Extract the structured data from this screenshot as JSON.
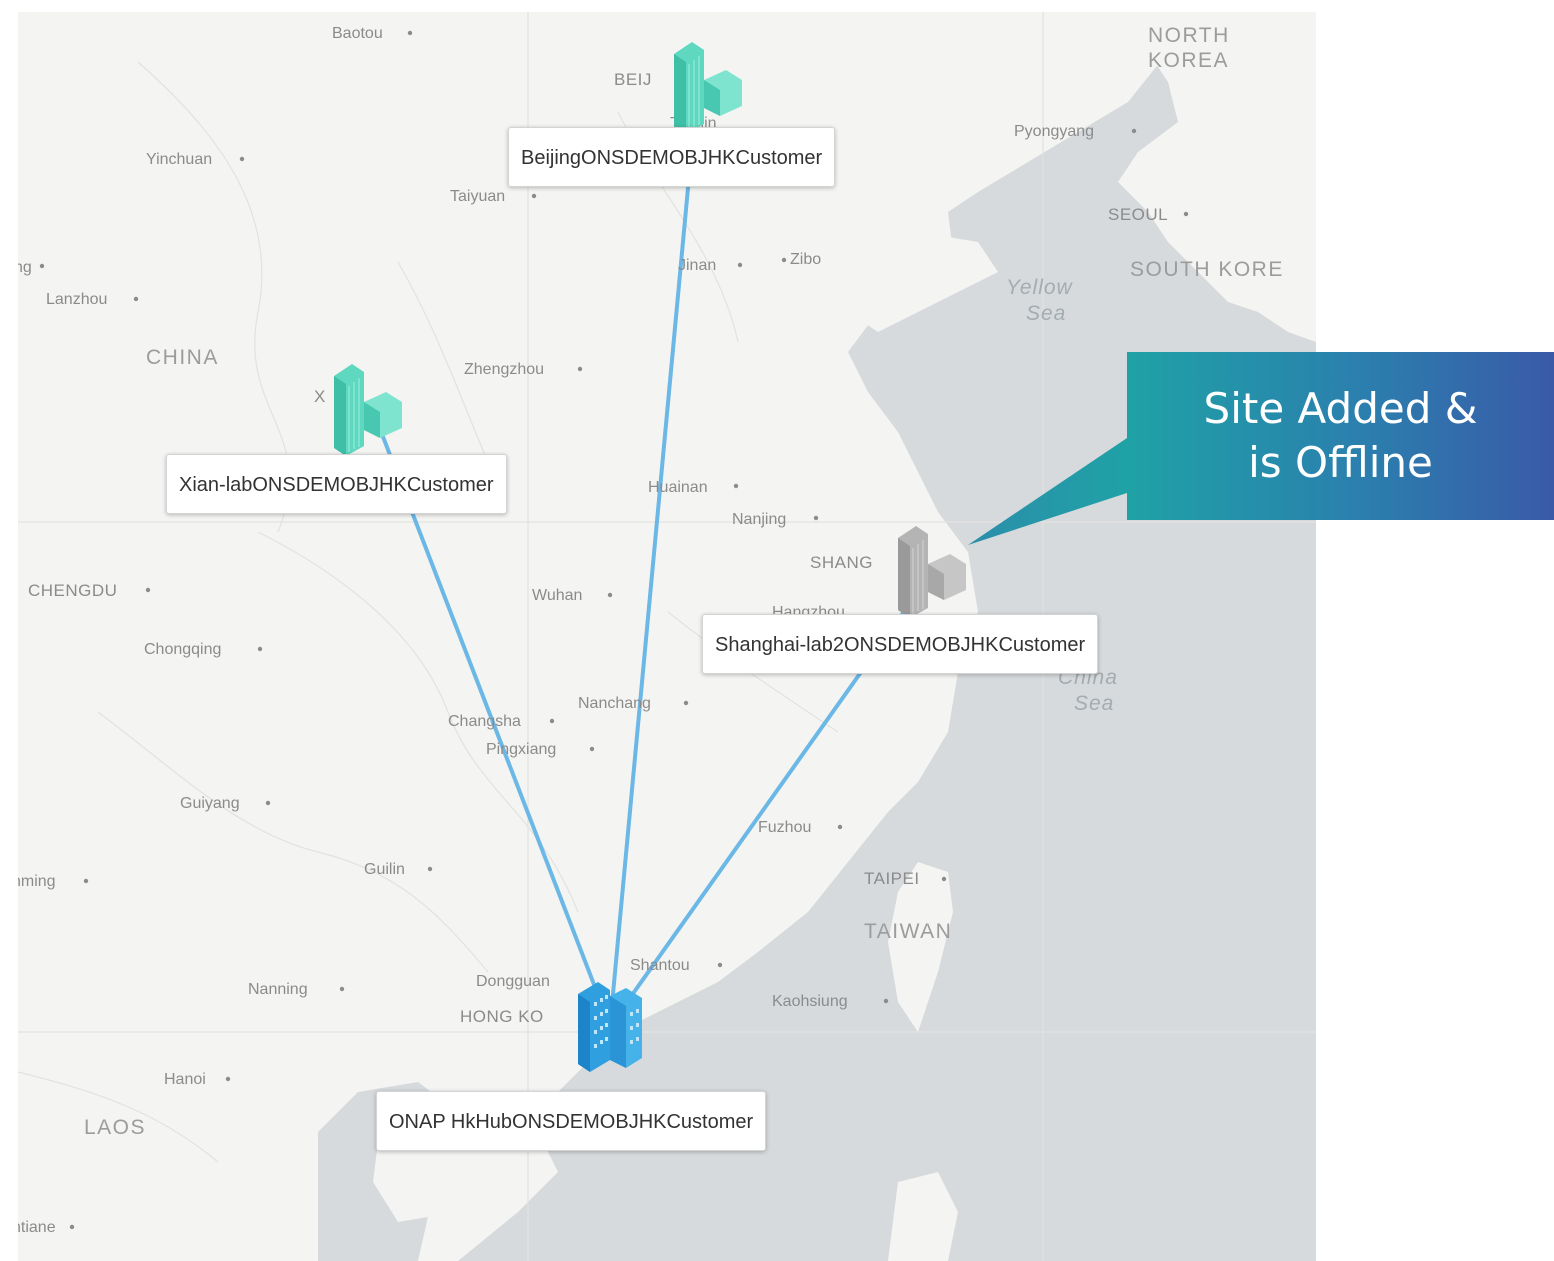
{
  "map": {
    "place_labels": [
      {
        "id": "baotou",
        "text": "Baotou"
      },
      {
        "id": "beij",
        "text": "BEIJ"
      },
      {
        "id": "tianjin",
        "text": "Tianjin"
      },
      {
        "id": "yinchuan",
        "text": "Yinchuan"
      },
      {
        "id": "taiyuan",
        "text": "Taiyuan"
      },
      {
        "id": "jinan",
        "text": "Jinan"
      },
      {
        "id": "zibo",
        "text": "Zibo"
      },
      {
        "id": "lanzhou",
        "text": "Lanzhou"
      },
      {
        "id": "xining",
        "text": "ng"
      },
      {
        "id": "china",
        "text": "CHINA"
      },
      {
        "id": "zhengzhou",
        "text": "Zhengzhou"
      },
      {
        "id": "xian",
        "text": "X"
      },
      {
        "id": "huainan",
        "text": "Huainan"
      },
      {
        "id": "nanjing",
        "text": "Nanjing"
      },
      {
        "id": "shanghai",
        "text": "SHANG"
      },
      {
        "id": "hangzhou",
        "text": "Hangzhou"
      },
      {
        "id": "chengdu",
        "text": "CHENGDU"
      },
      {
        "id": "wuhan",
        "text": "Wuhan"
      },
      {
        "id": "chongqing",
        "text": "Chongqing"
      },
      {
        "id": "nanchang",
        "text": "Nanchang"
      },
      {
        "id": "changsha",
        "text": "Changsha"
      },
      {
        "id": "pingxiang",
        "text": "Pingxiang"
      },
      {
        "id": "guiyang",
        "text": "Guiyang"
      },
      {
        "id": "fuzhou",
        "text": "Fuzhou"
      },
      {
        "id": "kunming",
        "text": "nming"
      },
      {
        "id": "guilin",
        "text": "Guilin"
      },
      {
        "id": "taipei",
        "text": "TAIPEI"
      },
      {
        "id": "taiwan",
        "text": "TAIWAN"
      },
      {
        "id": "shantou",
        "text": "Shantou"
      },
      {
        "id": "dongguan",
        "text": "Dongguan"
      },
      {
        "id": "nanning",
        "text": "Nanning"
      },
      {
        "id": "hongkong",
        "text": "HONG KO"
      },
      {
        "id": "kaohsiung",
        "text": "Kaohsiung"
      },
      {
        "id": "hanoi",
        "text": "Hanoi"
      },
      {
        "id": "laos",
        "text": "LAOS"
      },
      {
        "id": "vientiane",
        "text": "ntiane"
      },
      {
        "id": "north_korea_1",
        "text": "NORTH"
      },
      {
        "id": "north_korea_2",
        "text": "KOREA"
      },
      {
        "id": "pyongyang",
        "text": "Pyongyang"
      },
      {
        "id": "seoul",
        "text": "SEOUL"
      },
      {
        "id": "south_korea",
        "text": "SOUTH KORE"
      },
      {
        "id": "yellow_sea_1",
        "text": "Yellow"
      },
      {
        "id": "yellow_sea_2",
        "text": "Sea"
      },
      {
        "id": "east_china_sea_1",
        "text": "China"
      },
      {
        "id": "east_china_sea_2",
        "text": "Sea"
      }
    ]
  },
  "sites": [
    {
      "id": "beijing",
      "label": "BeijingONSDEMOBJHKCustomer",
      "status": "online",
      "color": "#5fd8c0"
    },
    {
      "id": "xian",
      "label": "Xian-labONSDEMOBJHKCustomer",
      "status": "online",
      "color": "#5fd8c0"
    },
    {
      "id": "shanghai",
      "label": "Shanghai-lab2ONSDEMOBJHKCustomer",
      "status": "offline",
      "color": "#a8a8a8"
    },
    {
      "id": "hkhub",
      "label": "ONAP HkHubONSDEMOBJHKCustomer",
      "status": "hub",
      "color": "#2f9fe0"
    }
  ],
  "links": [
    {
      "from": "hkhub",
      "to": "beijing"
    },
    {
      "from": "hkhub",
      "to": "xian"
    },
    {
      "from": "hkhub",
      "to": "shanghai"
    }
  ],
  "callout": {
    "line1": "Site Added &",
    "line2": "is Offline"
  },
  "colors": {
    "link": "#6bb7e6",
    "sea": "#d6dadc",
    "land": "#f4f4f2",
    "callout_start": "#1fa2a6",
    "callout_end": "#3a5aa8"
  }
}
